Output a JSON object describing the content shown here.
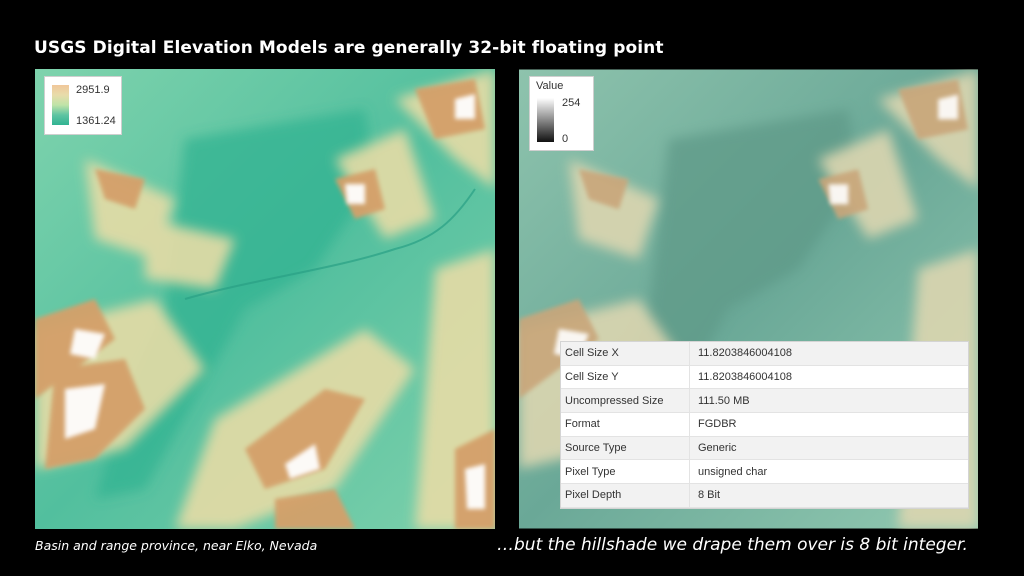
{
  "title": "USGS Digital Elevation Models are generally 32-bit floating point",
  "left_map": {
    "legend": {
      "max_label": "2951.9",
      "min_label": "1361.24"
    },
    "caption": "Basin and range province, near Elko, Nevada"
  },
  "right_map": {
    "legend": {
      "title": "Value",
      "max_label": "254",
      "min_label": "0"
    },
    "properties": [
      {
        "key": "Cell Size X",
        "value": "11.8203846004108"
      },
      {
        "key": "Cell Size Y",
        "value": "11.8203846004108"
      },
      {
        "key": "Uncompressed Size",
        "value": "111.50 MB"
      },
      {
        "key": "Format",
        "value": "FGDBR"
      },
      {
        "key": "Source Type",
        "value": "Generic"
      },
      {
        "key": "Pixel Type",
        "value": "unsigned char"
      },
      {
        "key": "Pixel Depth",
        "value": "8 Bit"
      }
    ],
    "caption": "…but the hillshade we drape them over is 8 bit integer."
  },
  "colors": {
    "background": "#000000",
    "valley": "#31b392",
    "low": "#9fdcb0",
    "mid": "#e8dcaa",
    "high": "#d7a86f",
    "peak": "#ffffff"
  }
}
